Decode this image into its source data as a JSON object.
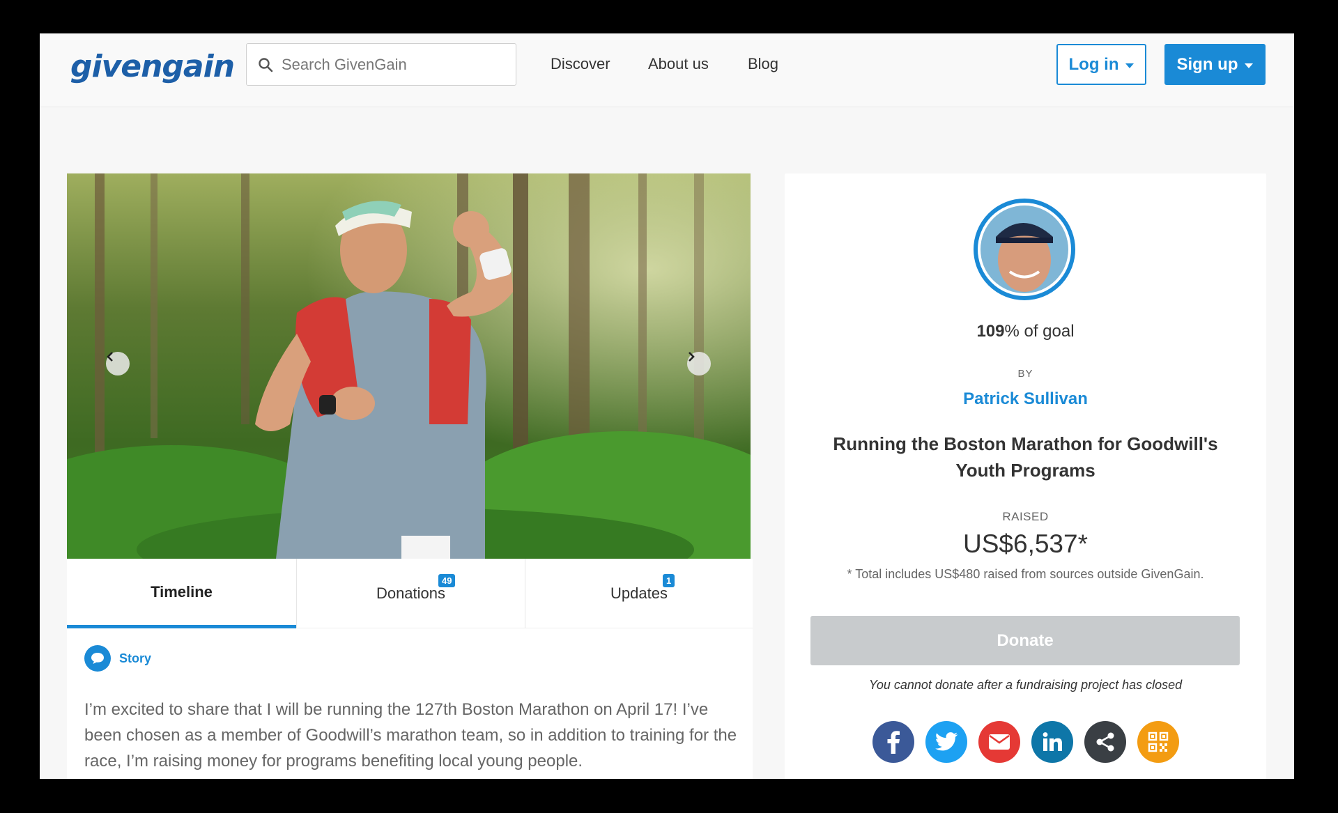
{
  "header": {
    "logo": "givengain",
    "search_placeholder": "Search GivenGain",
    "nav": [
      "Discover",
      "About us",
      "Blog"
    ],
    "login_label": "Log in",
    "signup_label": "Sign up"
  },
  "tabs": [
    {
      "label": "Timeline",
      "badge": null
    },
    {
      "label": "Donations",
      "badge": "49"
    },
    {
      "label": "Updates",
      "badge": "1"
    }
  ],
  "story": {
    "label": "Story",
    "text": "I’m excited to share that I will be running the 127th Boston Marathon on April 17! I’ve been chosen as a member of Goodwill’s marathon team, so in addition to training for the race, I’m raising money for programs benefiting local young people."
  },
  "project": {
    "goal_percent": "109",
    "goal_suffix": "% of goal",
    "by_label": "BY",
    "author": "Patrick Sullivan",
    "title": "Running the Boston Marathon for Goodwill's Youth Programs",
    "raised_label": "RAISED",
    "raised_amount": "US$6,537*",
    "raised_note": "* Total includes US$480 raised from sources outside GivenGain.",
    "donate_label": "Donate",
    "closed_note": "You cannot donate after a fundraising project has closed"
  },
  "share_icons": [
    "facebook-icon",
    "twitter-icon",
    "email-icon",
    "linkedin-icon",
    "share-icon",
    "qr-code-icon"
  ],
  "colors": {
    "accent": "#1a8ad6",
    "facebook": "#3b5998",
    "twitter": "#1da1f2",
    "email": "#e53935",
    "linkedin": "#0e76a8",
    "share": "#3a3f44",
    "qr": "#f39c12",
    "donate_disabled": "#c8cbcd"
  }
}
